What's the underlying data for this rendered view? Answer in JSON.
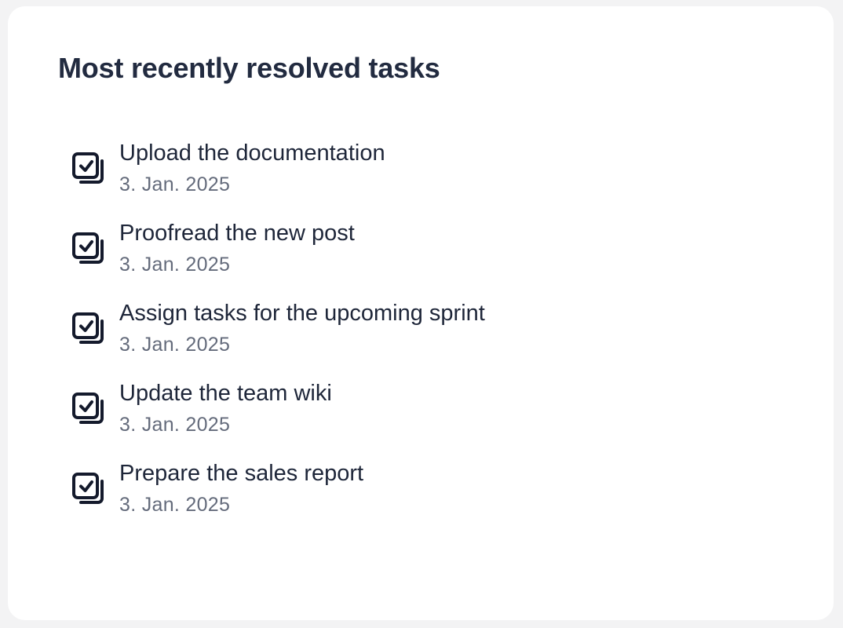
{
  "card": {
    "title": "Most recently resolved tasks"
  },
  "tasks": [
    {
      "title": "Upload the documentation",
      "date": "3. Jan. 2025",
      "icon": "checked-tasks-icon"
    },
    {
      "title": "Proofread the new post",
      "date": "3. Jan. 2025",
      "icon": "checked-tasks-icon"
    },
    {
      "title": "Assign tasks for the upcoming sprint",
      "date": "3. Jan. 2025",
      "icon": "checked-tasks-icon"
    },
    {
      "title": "Update the team wiki",
      "date": "3. Jan. 2025",
      "icon": "checked-tasks-icon"
    },
    {
      "title": "Prepare the sales report",
      "date": "3. Jan. 2025",
      "icon": "checked-tasks-icon"
    }
  ],
  "colors": {
    "background": "#f3f3f4",
    "card": "#ffffff",
    "title": "#222b40",
    "task_title": "#1e2639",
    "task_date": "#646b7b",
    "icon": "#141a2c"
  }
}
